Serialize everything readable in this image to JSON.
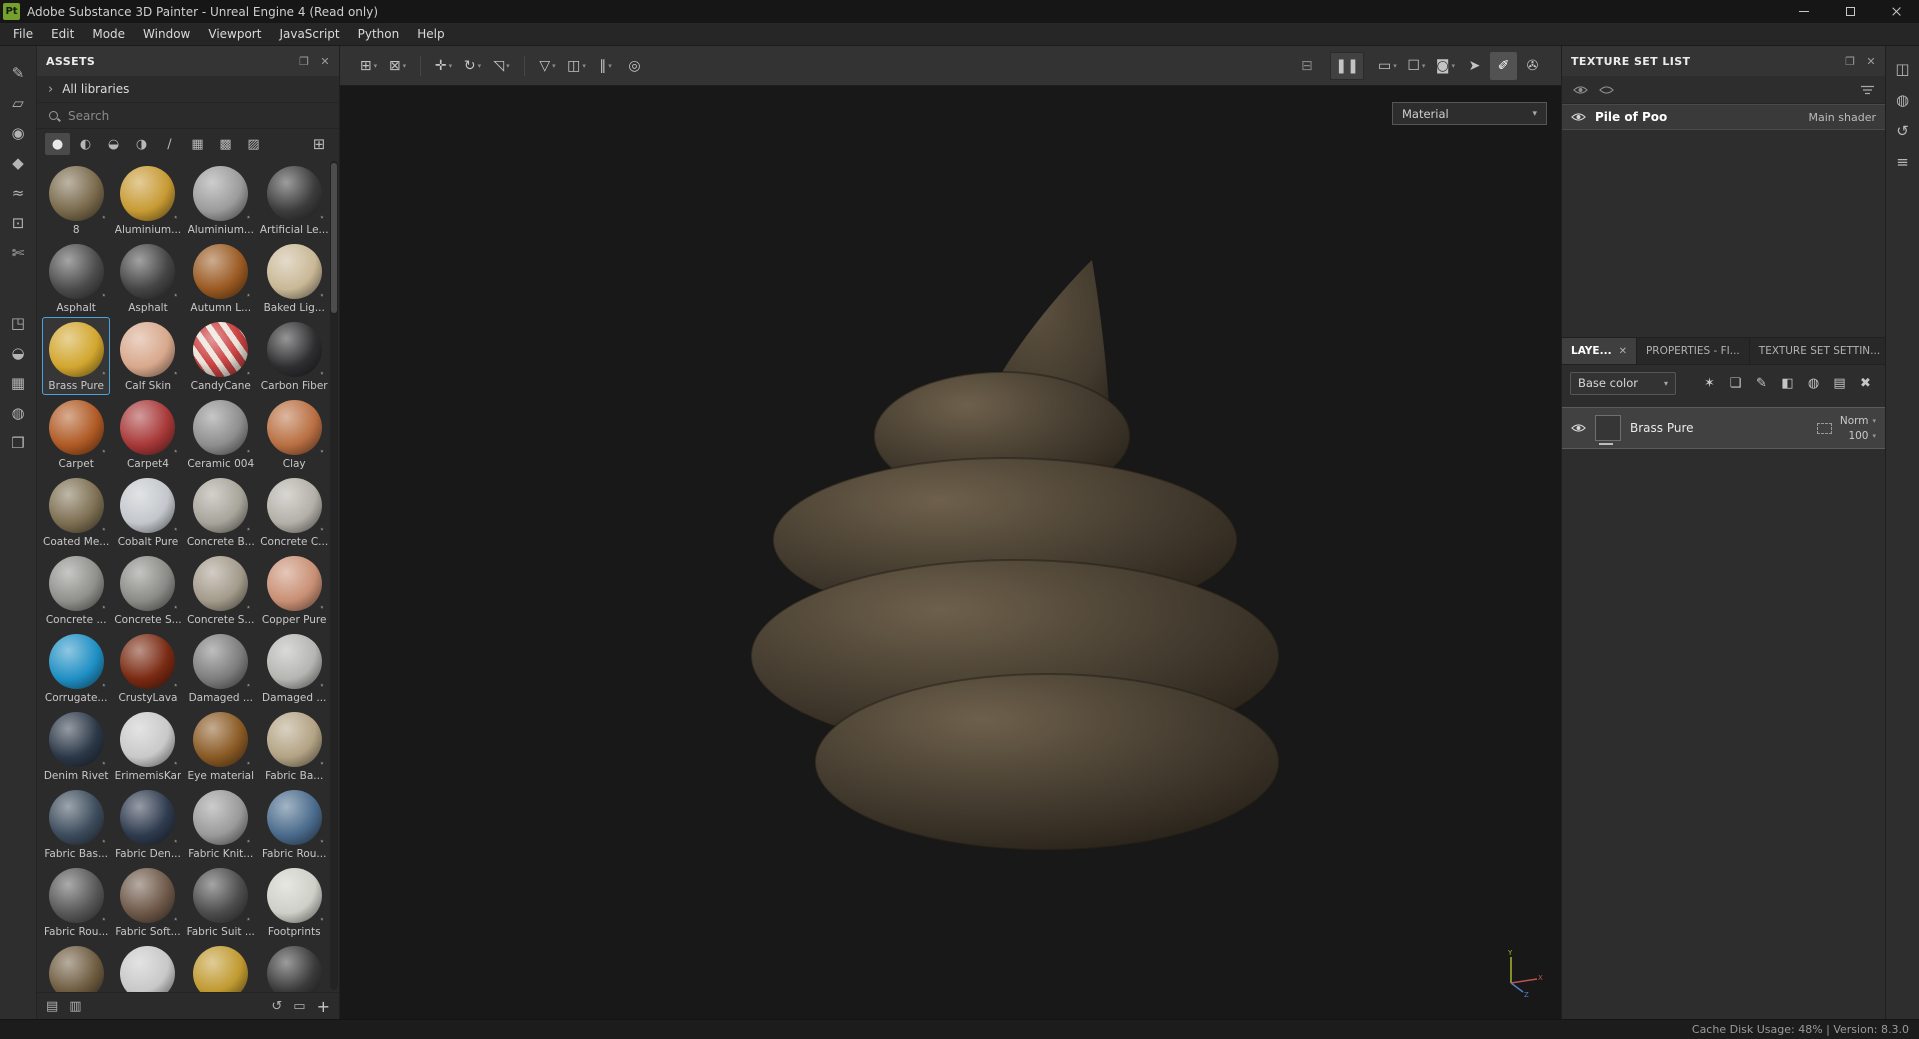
{
  "icons": {
    "close": "✕",
    "float": "❐",
    "chevron_right": "›",
    "caret": "▾",
    "plus": "+",
    "grid_view": "⊞",
    "refresh": "↺",
    "import_box": "▭",
    "star": "⋆"
  },
  "window": {
    "app_badge": "Pt",
    "title": "Adobe Substance 3D Painter - Unreal Engine 4 (Read only)"
  },
  "menu_bar": {
    "items": [
      {
        "label": "File"
      },
      {
        "label": "Edit"
      },
      {
        "label": "Mode"
      },
      {
        "label": "Window"
      },
      {
        "label": "Viewport"
      },
      {
        "label": "JavaScript"
      },
      {
        "label": "Python"
      },
      {
        "label": "Help"
      }
    ]
  },
  "left_toolbar": {
    "top_tools": [
      {
        "name": "paint-tool-icon",
        "glyph": "✎"
      },
      {
        "name": "eraser-tool-icon",
        "glyph": "▱"
      },
      {
        "name": "projection-tool-icon",
        "glyph": "◉"
      },
      {
        "name": "polygon-fill-tool-icon",
        "glyph": "◆"
      },
      {
        "name": "smudge-tool-icon",
        "glyph": "≈"
      },
      {
        "name": "clone-tool-icon",
        "glyph": "⊡"
      },
      {
        "name": "material-picker-tool-icon",
        "glyph": "✄"
      }
    ],
    "bottom_tools": [
      {
        "name": "export-textures-icon",
        "glyph": "◳"
      },
      {
        "name": "resources-updater-icon",
        "glyph": "◒"
      },
      {
        "name": "baking-mode-icon",
        "glyph": "▦"
      },
      {
        "name": "render-mode-icon",
        "glyph": "◍"
      },
      {
        "name": "shelf-panel-icon",
        "glyph": "❒"
      }
    ]
  },
  "assets_panel": {
    "title": "ASSETS",
    "library_toggle": "All libraries",
    "search_placeholder": "Search",
    "type_filters": [
      {
        "name": "filter-materials-icon",
        "glyph": "●",
        "selected": true
      },
      {
        "name": "filter-smart-materials-icon",
        "glyph": "◐"
      },
      {
        "name": "filter-smart-masks-icon",
        "glyph": "◒"
      },
      {
        "name": "filter-textures-icon",
        "glyph": "◑"
      },
      {
        "name": "filter-brushes-icon",
        "glyph": "∕"
      },
      {
        "name": "filter-alphas-icon",
        "glyph": "▦"
      },
      {
        "name": "filter-procedurals-icon",
        "glyph": "▩"
      },
      {
        "name": "filter-emitters-icon",
        "glyph": "▨"
      }
    ],
    "materials": [
      {
        "name": "8",
        "color": "#7a6a4c"
      },
      {
        "name": "Aluminium...",
        "color": "#c79a33"
      },
      {
        "name": "Aluminium...",
        "color": "#9b9b9b"
      },
      {
        "name": "Artificial Le...",
        "color": "#3c3c3c"
      },
      {
        "name": "Asphalt",
        "color": "#4c4c4c"
      },
      {
        "name": "Asphalt",
        "color": "#454545"
      },
      {
        "name": "Autumn L...",
        "color": "#9a5a22"
      },
      {
        "name": "Baked Lig...",
        "color": "#c9b896"
      },
      {
        "name": "Brass Pure",
        "color": "#d2a62e",
        "selected": true
      },
      {
        "name": "Calf Skin",
        "color": "#d8a88c"
      },
      {
        "name": "CandyCane",
        "color": "#cc4444",
        "pattern": "stripes"
      },
      {
        "name": "Carbon Fiber",
        "color": "#2e2e30"
      },
      {
        "name": "Carpet",
        "color": "#b05a24"
      },
      {
        "name": "Carpet4",
        "color": "#a83838"
      },
      {
        "name": "Ceramic 004",
        "color": "#8e8e8e"
      },
      {
        "name": "Clay",
        "color": "#b96f42"
      },
      {
        "name": "Coated Me...",
        "color": "#7d6f52"
      },
      {
        "name": "Cobalt Pure",
        "color": "#c3c7cc"
      },
      {
        "name": "Concrete B...",
        "color": "#a7a49a"
      },
      {
        "name": "Concrete C...",
        "color": "#b3b0a8"
      },
      {
        "name": "Concrete ...",
        "color": "#8f8f8b"
      },
      {
        "name": "Concrete S...",
        "color": "#8a8a86"
      },
      {
        "name": "Concrete S...",
        "color": "#a39a8a"
      },
      {
        "name": "Copper Pure",
        "color": "#c98f74"
      },
      {
        "name": "Corrugate...",
        "color": "#1f8fc4"
      },
      {
        "name": "CrustyLava",
        "color": "#7a2a12"
      },
      {
        "name": "Damaged ...",
        "color": "#7d7d7d"
      },
      {
        "name": "Damaged ...",
        "color": "#b5b5b2"
      },
      {
        "name": "Denim Rivet",
        "color": "#2c3848"
      },
      {
        "name": "ErimemisKar",
        "color": "#c9c9c9"
      },
      {
        "name": "Eye material",
        "color": "#8a5a24"
      },
      {
        "name": "Fabric Ba...",
        "color": "#b3a384"
      },
      {
        "name": "Fabric Bas...",
        "color": "#3c4c5c"
      },
      {
        "name": "Fabric Den...",
        "color": "#2f3b4f"
      },
      {
        "name": "Fabric Knit...",
        "color": "#9a9a9a"
      },
      {
        "name": "Fabric Rou...",
        "color": "#4a6b8c"
      },
      {
        "name": "Fabric Rou...",
        "color": "#585858"
      },
      {
        "name": "Fabric Soft...",
        "color": "#6e5848"
      },
      {
        "name": "Fabric Suit ...",
        "color": "#4c4c4c"
      },
      {
        "name": "Footprints",
        "color": "#cfcfc8"
      },
      {
        "name": "",
        "color": "#6e5c40"
      },
      {
        "name": "",
        "color": "#c8c8c8"
      },
      {
        "name": "",
        "color": "#c09a30"
      },
      {
        "name": "",
        "color": "#3a3a3a"
      }
    ],
    "footer_left": [
      {
        "name": "list-view-toggle-icon",
        "glyph": "▤"
      },
      {
        "name": "details-view-toggle-icon",
        "glyph": "▥"
      }
    ],
    "footer_right": [
      {
        "name": "refresh-assets-icon",
        "glyph": "↺"
      },
      {
        "name": "import-resources-icon",
        "glyph": "▭"
      }
    ],
    "add_button": "+"
  },
  "viewport_toolbar": {
    "left_tools": [
      {
        "name": "snap-transform-icon",
        "glyph": "⊞",
        "caret": true
      },
      {
        "name": "warp-transform-icon",
        "glyph": "⊠",
        "caret": true
      },
      {
        "sep": true
      },
      {
        "name": "move-icon",
        "glyph": "✛",
        "caret": true
      },
      {
        "name": "rotate-icon",
        "glyph": "↻",
        "caret": true
      },
      {
        "name": "scale-icon",
        "glyph": "◹",
        "caret": true
      },
      {
        "sep": true
      },
      {
        "name": "quick-mask-icon",
        "glyph": "▽",
        "caret": true
      },
      {
        "name": "symmetry-icon",
        "glyph": "◫",
        "caret": true
      },
      {
        "name": "falloff-icon",
        "glyph": "∥",
        "caret": true
      },
      {
        "name": "lazy-mouse-icon",
        "glyph": "◎"
      }
    ],
    "right_tools": [
      {
        "name": "perspective-toggle-icon",
        "glyph": "⊟",
        "dim": true
      },
      {
        "name": "pause-engine-icon",
        "glyph": "❚❚",
        "boxed": true
      },
      {
        "name": "material-view-icon",
        "glyph": "▭",
        "caret": true
      },
      {
        "name": "mesh-view-icon",
        "glyph": "☐",
        "caret": true
      },
      {
        "name": "camera-settings-icon",
        "glyph": "◙",
        "caret": true
      },
      {
        "name": "pointer-mode-icon",
        "glyph": "➤"
      },
      {
        "name": "brush-mode-icon",
        "glyph": "✐",
        "active": true
      },
      {
        "name": "viewport-capture-icon",
        "glyph": "✇"
      }
    ]
  },
  "viewport": {
    "shader_dropdown_value": "Material",
    "gizmo": {
      "x_label": "X",
      "y_label": "Y",
      "z_label": "Z"
    }
  },
  "texture_set_list": {
    "title": "TEXTURE SET LIST",
    "rows": [
      {
        "name": "Pile of Poo",
        "shader": "Main shader"
      }
    ]
  },
  "layers_panel": {
    "tabs": [
      {
        "label": "LAYE...",
        "active": true,
        "closable": true
      },
      {
        "label": "PROPERTIES - FI..."
      },
      {
        "label": "TEXTURE SET SETTIN..."
      }
    ],
    "channel_selector": "Base color",
    "toolbar_icons": [
      {
        "name": "add-effect-icon",
        "glyph": "✶"
      },
      {
        "name": "add-fill-layer-icon",
        "glyph": "❏"
      },
      {
        "name": "add-paint-layer-icon",
        "glyph": "✎"
      },
      {
        "name": "bucket-fill-icon",
        "glyph": "◧"
      },
      {
        "name": "add-smart-material-icon",
        "glyph": "◍"
      },
      {
        "name": "add-group-icon",
        "glyph": "▤"
      },
      {
        "name": "delete-layer-icon",
        "glyph": "✖"
      }
    ],
    "layers": [
      {
        "name": "Brass Pure",
        "blend": "Norm",
        "opacity": "100",
        "selected": true
      }
    ]
  },
  "right_toolbar": {
    "tools": [
      {
        "name": "display-settings-icon",
        "glyph": "◫"
      },
      {
        "name": "shader-settings-icon",
        "glyph": "◍"
      },
      {
        "name": "history-icon",
        "glyph": "↺"
      },
      {
        "name": "log-icon",
        "glyph": "≡"
      }
    ]
  },
  "status_bar": {
    "right_text": "Cache Disk Usage:  48% | Version: 8.3.0"
  }
}
